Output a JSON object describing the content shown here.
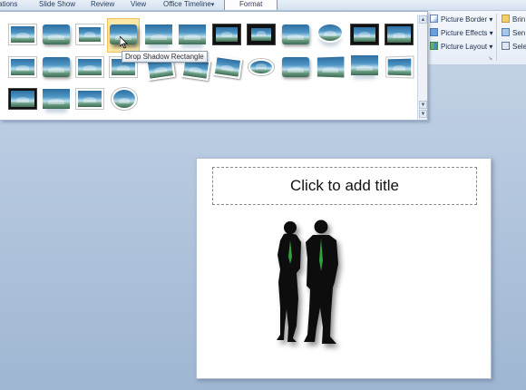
{
  "tabs": [
    {
      "label": "ations"
    },
    {
      "label": "Slide Show"
    },
    {
      "label": "Review"
    },
    {
      "label": "View"
    },
    {
      "label": "Office Timeline"
    },
    {
      "label": "Format"
    }
  ],
  "tab_dropdown_glyph": "▾",
  "gallery": {
    "tooltip": "Drop Shadow Rectangle",
    "scroll_up": "▲",
    "scroll_down": "▼",
    "scroll_more": "▼"
  },
  "picture_tools": {
    "border_label": "Picture Border",
    "effects_label": "Picture Effects",
    "layout_label": "Picture Layout",
    "dropdown_glyph": "▾",
    "dialog_launcher": "↘"
  },
  "arrange": {
    "bring_label": "Brin",
    "send_label": "Sen",
    "select_label": "Sele"
  },
  "slide": {
    "title_placeholder": "Click to add title"
  },
  "colors": {
    "tie_green": "#2fa23a",
    "tab_accent": "#c56cc0"
  }
}
